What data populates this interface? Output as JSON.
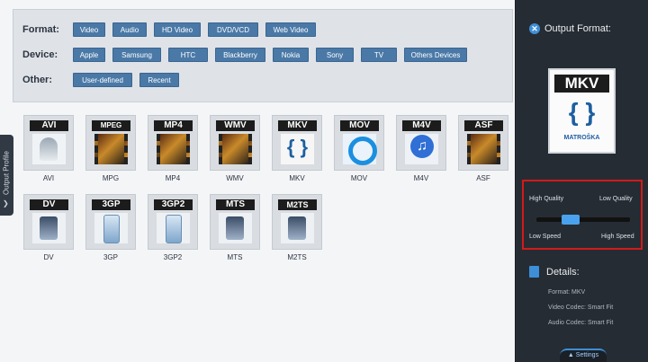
{
  "filters": {
    "format": {
      "label": "Format:",
      "options": [
        "Video",
        "Audio",
        "HD Video",
        "DVD/VCD",
        "Web Video"
      ]
    },
    "device": {
      "label": "Device:",
      "options": [
        "Apple",
        "Samsung",
        "HTC",
        "Blackberry",
        "Nokia",
        "Sony",
        "TV",
        "Others Devices"
      ]
    },
    "other": {
      "label": "Other:",
      "options": [
        "User-defined",
        "Recent"
      ]
    }
  },
  "sidebar_tab": {
    "label": "Output Profile",
    "arrow": "❯"
  },
  "formats": [
    {
      "badge": "AVI",
      "caption": "AVI",
      "icon": "person-video-icon"
    },
    {
      "badge": "MPEG",
      "caption": "MPG",
      "icon": "film-strip-icon"
    },
    {
      "badge": "MP4",
      "caption": "MP4",
      "icon": "film-strip-icon"
    },
    {
      "badge": "WMV",
      "caption": "WMV",
      "icon": "film-strip-icon"
    },
    {
      "badge": "MKV",
      "caption": "MKV",
      "icon": "matroska-icon"
    },
    {
      "badge": "MOV",
      "caption": "MOV",
      "icon": "quicktime-icon"
    },
    {
      "badge": "M4V",
      "caption": "M4V",
      "icon": "itunes-icon"
    },
    {
      "badge": "ASF",
      "caption": "ASF",
      "icon": "film-strip-icon"
    },
    {
      "badge": "DV",
      "caption": "DV",
      "icon": "camcorder-icon"
    },
    {
      "badge": "3GP",
      "caption": "3GP",
      "icon": "phone-icon"
    },
    {
      "badge": "3GP2",
      "caption": "3GP2",
      "icon": "phone-icon"
    },
    {
      "badge": "MTS",
      "caption": "MTS",
      "icon": "camcorder-icon"
    },
    {
      "badge": "M2TS",
      "caption": "M2TS",
      "icon": "camcorder-icon"
    }
  ],
  "output": {
    "title": "Output Format:",
    "preview_badge": "MKV",
    "preview_mark": "{ }",
    "preview_name": "MATROŠKA"
  },
  "quality": {
    "high_quality": "High Quality",
    "low_quality": "Low Quality",
    "low_speed": "Low Speed",
    "high_speed": "High Speed",
    "slider_fraction": 0.33
  },
  "details": {
    "title": "Details:",
    "format": "Format: MKV",
    "video_codec": "Video Codec: Smart Fit",
    "audio_codec": "Audio Codec: Smart Fit"
  },
  "settings_label": "▲ Settings"
}
